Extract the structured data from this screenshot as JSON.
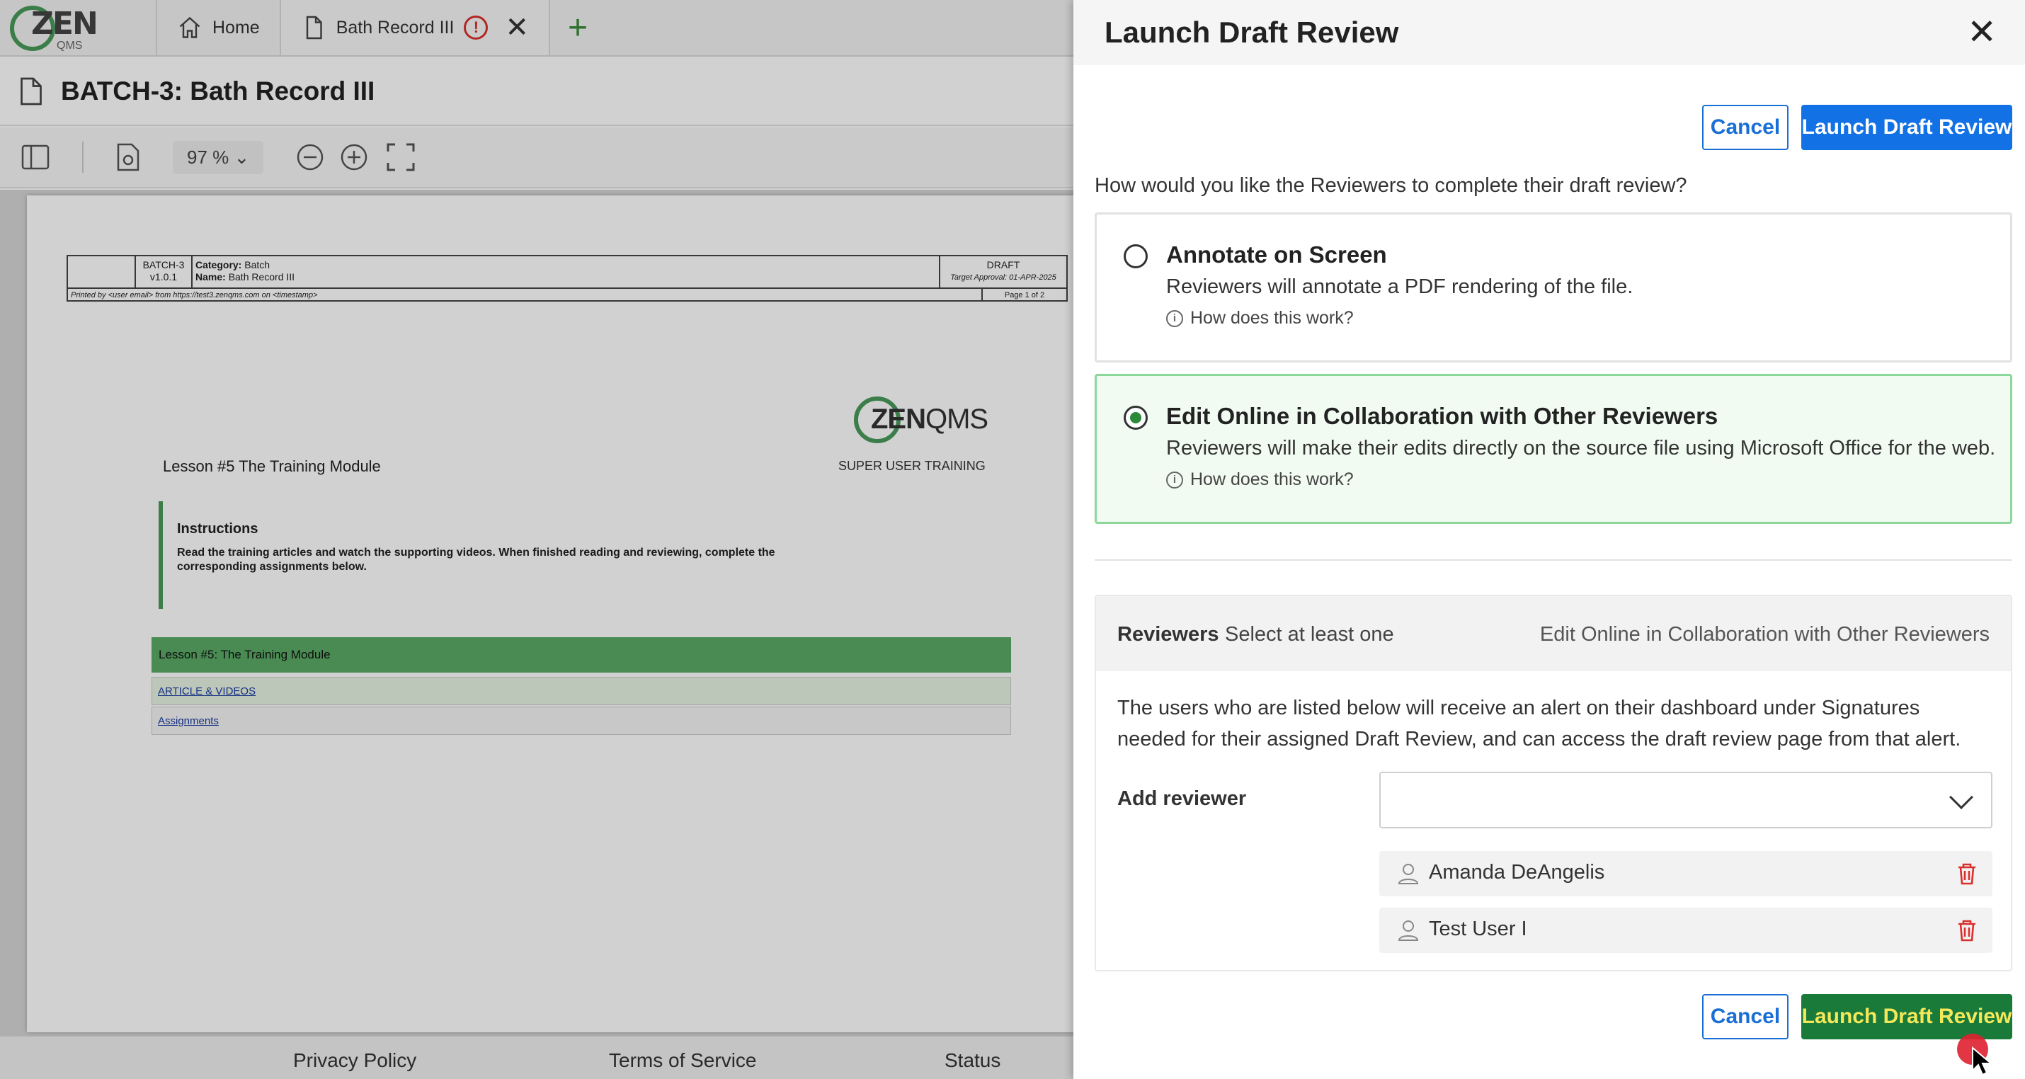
{
  "app": {
    "logo_text": "ZEN",
    "logo_sub": "QMS",
    "tabs": [
      {
        "label": "Home"
      },
      {
        "label": "Bath Record III"
      }
    ],
    "doc_title": "BATCH-3: Bath Record III",
    "zoom": "97 %",
    "footer": {
      "privacy": "Privacy Policy",
      "terms": "Terms of Service",
      "status": "Status"
    }
  },
  "document": {
    "header": {
      "doc_id": "BATCH-3",
      "version": "v1.0.1",
      "category_label": "Category:",
      "category": "Batch",
      "name_label": "Name:",
      "name": "Bath Record III",
      "state": "DRAFT",
      "target": "Target Approval: 01-APR-2025",
      "printed_by": "Printed by <user email> from https://test3.zenqms.com on <timestamp>",
      "page": "Page 1 of 2"
    },
    "logo_zen": "ZEN",
    "logo_qms": "QMS",
    "subtitle": "SUPER USER TRAINING",
    "lesson_title": "Lesson #5 The Training Module",
    "instructions_heading": "Instructions",
    "instructions_body": "Read the training articles and watch the supporting videos. When finished reading and reviewing, complete the corresponding assignments below.",
    "lesson_bar": "Lesson #5: The Training Module",
    "link1": "ARTICLE & VIDEOS",
    "link2": "Assignments"
  },
  "drawer": {
    "title": "Launch Draft Review",
    "cancel": "Cancel",
    "launch": "Launch Draft Review",
    "question": "How would you like the Reviewers to complete their draft review?",
    "options": [
      {
        "title": "Annotate on Screen",
        "desc": "Reviewers will annotate a PDF rendering of the file.",
        "help": "How does this work?",
        "selected": false
      },
      {
        "title": "Edit Online in Collaboration with Other Reviewers",
        "desc": "Reviewers will make their edits directly on the source file using Microsoft Office for the web.",
        "help": "How does this work?",
        "selected": true
      }
    ],
    "reviewers": {
      "label": "Reviewers",
      "hint": "Select at least one",
      "mode": "Edit Online in Collaboration with Other Reviewers",
      "text": "The users who are listed below will receive an alert on their dashboard under Signatures needed for their assigned Draft Review, and can access the draft review page from that alert.",
      "add_label": "Add reviewer",
      "select_value": "",
      "list": [
        "Amanda DeAngelis",
        "Test User I"
      ]
    }
  },
  "colors": {
    "primary": "#1371e6",
    "success": "#2a8a3a",
    "danger": "#d9302c",
    "brand_green": "#4a9a5a"
  }
}
